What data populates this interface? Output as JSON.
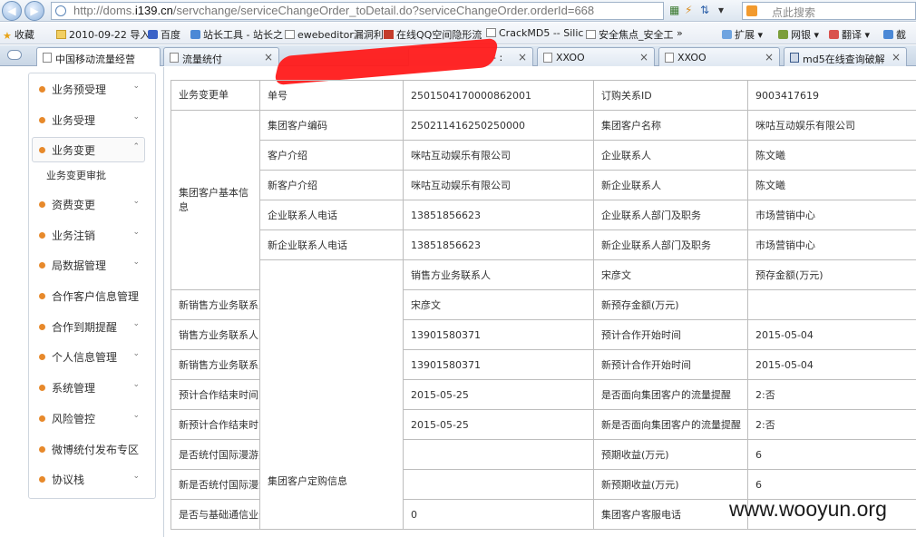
{
  "browser": {
    "url_prefix": "http://doms.",
    "url_domain": "i139.cn",
    "url_path": "/servchange/serviceChangeOrder_toDetail.do?serviceChangeOrder.orderId=668",
    "search_placeholder": "点此搜索",
    "bookmarks": [
      {
        "label": "收藏",
        "icon": "star-icon"
      },
      {
        "label": "2010-09-22 导入",
        "icon": "folder-icon"
      },
      {
        "label": "百度",
        "icon": "paw-icon"
      },
      {
        "label": "站长工具 - 站长之",
        "icon": "tool-icon"
      },
      {
        "label": "ewebeditor漏洞利",
        "icon": "page-icon"
      },
      {
        "label": "在线QQ空间隐形流",
        "icon": "qq-icon"
      },
      {
        "label": "CrackMD5 -- Silic",
        "icon": "page-icon"
      },
      {
        "label": "安全焦点_安全工",
        "icon": "page-icon"
      }
    ],
    "bookmark_more": "»",
    "toolbar_right": [
      "扩展",
      "网银",
      "翻译",
      "截"
    ],
    "tabs": [
      {
        "label": "中国移动流量经营",
        "active": true
      },
      {
        "label": "流量统付",
        "active": false
      },
      {
        "label": "- :",
        "active": false
      },
      {
        "label": "XXOO",
        "active": false
      },
      {
        "label": "XXOO",
        "active": false
      },
      {
        "label": "md5在线查询破解",
        "active": false
      }
    ]
  },
  "sidebar": {
    "items": [
      {
        "label": "业务预受理"
      },
      {
        "label": "业务受理"
      },
      {
        "label": "业务变更",
        "active": true,
        "sub": [
          "业务变更审批"
        ]
      },
      {
        "label": "资费变更"
      },
      {
        "label": "业务注销"
      },
      {
        "label": "局数据管理"
      },
      {
        "label": "合作客户信息管理"
      },
      {
        "label": "合作到期提醒"
      },
      {
        "label": "个人信息管理"
      },
      {
        "label": "系统管理"
      },
      {
        "label": "风险管控"
      },
      {
        "label": "微博统付发布专区"
      },
      {
        "label": "协议栈"
      }
    ]
  },
  "detail": {
    "rows": [
      {
        "group": "业务变更单",
        "rowspan": 1,
        "cells": [
          "单号",
          "2501504170000862001",
          "订购关系ID",
          "9003417619"
        ]
      },
      {
        "group": "集团客户基本信息",
        "rowspan": 6,
        "cells": [
          "集团客户编码",
          "250211416250250000",
          "集团客户名称",
          "咪咕互动娱乐有限公司"
        ]
      },
      {
        "cells": [
          "客户介绍",
          "咪咕互动娱乐有限公司",
          "企业联系人",
          "陈文曦"
        ]
      },
      {
        "cells": [
          "新客户介绍",
          "咪咕互动娱乐有限公司",
          "新企业联系人",
          "陈文曦"
        ]
      },
      {
        "cells": [
          "企业联系人电话",
          "13851856623",
          "企业联系人部门及职务",
          "市场营销中心"
        ]
      },
      {
        "cells": [
          "新企业联系人电话",
          "13851856623",
          "新企业联系人部门及职务",
          "市场营销中心"
        ]
      },
      {
        "group": "集团客户定购信息",
        "rowspan": 9,
        "cells": [
          "销售方业务联系人",
          "宋彦文",
          "预存金额(万元)",
          ""
        ]
      },
      {
        "cells": [
          "新销售方业务联系人",
          "宋彦文",
          "新预存金额(万元)",
          ""
        ]
      },
      {
        "cells": [
          "销售方业务联系人电话",
          "13901580371",
          "预计合作开始时间",
          "2015-05-04"
        ]
      },
      {
        "cells": [
          "新销售方业务联系人电话",
          "13901580371",
          "新预计合作开始时间",
          "2015-05-04"
        ]
      },
      {
        "cells": [
          "预计合作结束时间",
          "2015-05-25",
          "是否面向集团客户的流量提醒",
          "2:否"
        ]
      },
      {
        "cells": [
          "新预计合作结束时间",
          "2015-05-25",
          "新是否面向集团客户的流量提醒",
          "2:否"
        ]
      },
      {
        "cells": [
          "是否统付国际漫游费用",
          "",
          "预期收益(万元)",
          "6"
        ]
      },
      {
        "cells": [
          "新是否统付国际漫游费用",
          "",
          "新预期收益(万元)",
          "6"
        ]
      },
      {
        "cells": [
          "是否与基础通信业务存在竞争",
          "0",
          "集团客户客服电话",
          ""
        ]
      }
    ]
  },
  "watermark": "www.wooyun.org"
}
